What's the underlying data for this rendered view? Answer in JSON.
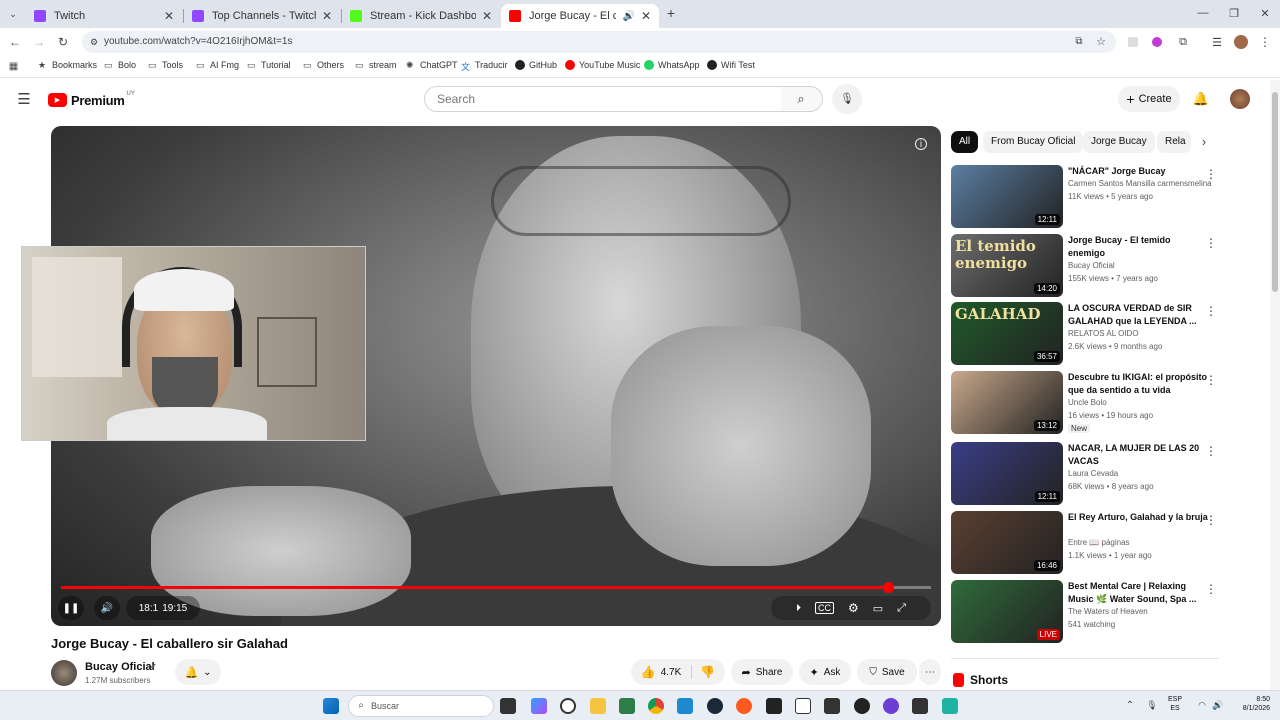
{
  "browser": {
    "tabs": [
      {
        "label": "Twitch"
      },
      {
        "label": "Top Channels - Twitch"
      },
      {
        "label": "Stream - Kick Dashboard"
      },
      {
        "label": "Jorge Bucay - El caballero s"
      }
    ],
    "url": "youtube.com/watch?v=4O216IrjhOM&t=1s",
    "bookmarks": [
      {
        "label": "Bookmarks"
      },
      {
        "label": "Bolo"
      },
      {
        "label": "Tools"
      },
      {
        "label": "AI Fmg"
      },
      {
        "label": "Tutorial"
      },
      {
        "label": "Others"
      },
      {
        "label": "stream"
      },
      {
        "label": "ChatGPT"
      },
      {
        "label": "Traducir"
      },
      {
        "label": "GitHub"
      },
      {
        "label": "YouTube Music"
      },
      {
        "label": "WhatsApp"
      },
      {
        "label": "Wifi Test"
      }
    ]
  },
  "youtube": {
    "logo_text": "Premium",
    "logo_region": "UY",
    "search_placeholder": "Search",
    "create_label": "Create",
    "player": {
      "time_current": "18:1",
      "time_total": "19:15",
      "progress_fraction": 0.95
    },
    "video": {
      "title": "Jorge Bucay - El caballero sir Galahad",
      "channel": "Bucay Oficial",
      "subscribers": "1.27M subscribers",
      "likes": "4.7K",
      "share_label": "Share",
      "ask_label": "Ask",
      "save_label": "Save"
    },
    "chips": [
      "All",
      "From Bucay Oficial",
      "Jorge Bucay",
      "Rela"
    ],
    "recommendations": [
      {
        "title": "\"NÁCAR\" Jorge Bucay",
        "channel": "Carmen Santos Mansilla carmensmelina",
        "meta": "11K views • 5 years ago",
        "duration": "12:11",
        "color": "#5b7fa3"
      },
      {
        "title": "Jorge Bucay - El temido enemigo",
        "channel": "Bucay Oficial",
        "meta": "155K views • 7 years ago",
        "duration": "14:20",
        "color": "#6d6d6d",
        "thumb_text": "El temido enemigo"
      },
      {
        "title": "LA OSCURA VERDAD de SIR GALAHAD que la LEYENDA ...",
        "channel": "RELATOS AL OIDO",
        "meta": "2.6K views • 9 months ago",
        "duration": "36:57",
        "color": "#1f5a2a",
        "thumb_text": "GALAHAD"
      },
      {
        "title": "Descubre tu IKIGAI: el propósito que da sentido a tu vida",
        "channel": "Uncle Bolo",
        "meta": "16 views • 19 hours ago",
        "duration": "13:12",
        "color": "#c9a98c",
        "badge": "New"
      },
      {
        "title": "NACAR, LA MUJER DE LAS 20 VACAS",
        "channel": "Laura Cevada",
        "meta": "68K views • 8 years ago",
        "duration": "12:11",
        "color": "#3b3f86"
      },
      {
        "title": "El Rey Arturo, Galahad y la bruja",
        "channel": "Entre 📖 páginas",
        "meta": "1.1K views • 1 year ago",
        "duration": "16:46",
        "color": "#5a4032"
      },
      {
        "title": "Best Mental Care | Relaxing Music 🌿 Water Sound, Spa ...",
        "channel": "The Waters of Heaven",
        "meta": "541 watching",
        "duration": "LIVE",
        "color": "#2f6b3a"
      }
    ],
    "shorts_label": "Shorts"
  },
  "taskbar": {
    "search_placeholder": "Buscar",
    "lang_top": "ESP",
    "lang_bottom": "ES",
    "time": "8:50",
    "date": "8/1/2026"
  }
}
